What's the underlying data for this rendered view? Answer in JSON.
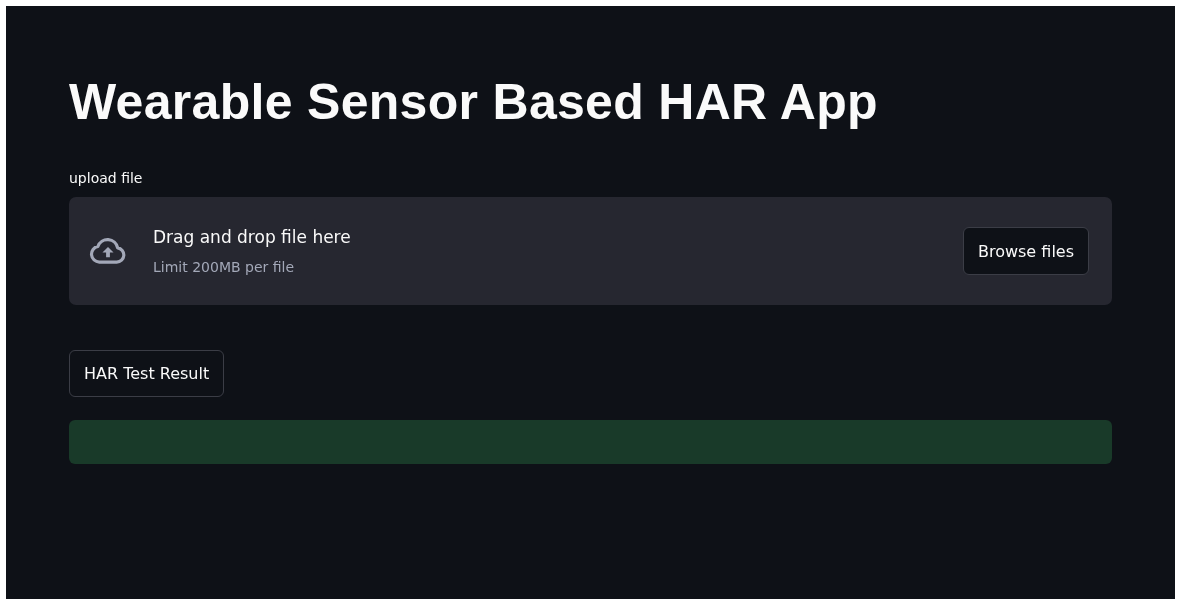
{
  "title": "Wearable Sensor Based HAR App",
  "uploader": {
    "label": "upload file",
    "instruction": "Drag and drop file here",
    "limit": "Limit 200MB per file",
    "button": "Browse files"
  },
  "action_button": "HAR Test Result",
  "result_alert": {
    "kind": "success"
  }
}
